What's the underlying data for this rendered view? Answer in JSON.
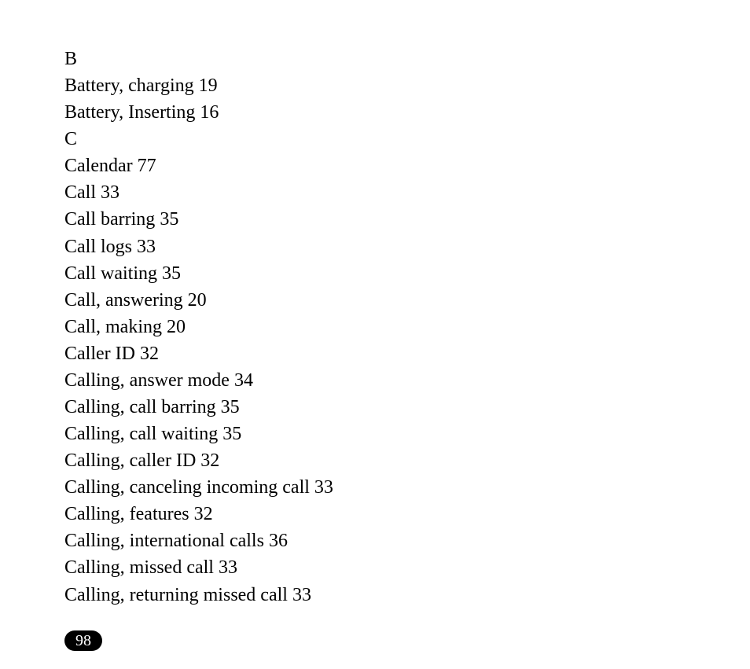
{
  "index": {
    "sections": [
      {
        "letter": "B",
        "entries": [
          {
            "term": "Battery, charging",
            "page": "19"
          },
          {
            "term": "Battery, Inserting",
            "page": "16"
          }
        ]
      },
      {
        "letter": "C",
        "entries": [
          {
            "term": "Calendar",
            "page": "77"
          },
          {
            "term": "Call",
            "page": "33"
          },
          {
            "term": "Call barring",
            "page": "35"
          },
          {
            "term": "Call logs",
            "page": "33"
          },
          {
            "term": "Call waiting",
            "page": "35"
          },
          {
            "term": "Call, answering",
            "page": "20"
          },
          {
            "term": "Call, making",
            "page": "20"
          },
          {
            "term": "Caller ID",
            "page": "32"
          },
          {
            "term": "Calling, answer mode",
            "page": "34"
          },
          {
            "term": "Calling, call barring",
            "page": "35"
          },
          {
            "term": "Calling, call waiting",
            "page": "35"
          },
          {
            "term": "Calling, caller ID",
            "page": "32"
          },
          {
            "term": "Calling, canceling incoming call",
            "page": "33"
          },
          {
            "term": "Calling, features",
            "page": "32"
          },
          {
            "term": "Calling, international calls",
            "page": "36"
          },
          {
            "term": "Calling, missed call",
            "page": "33"
          },
          {
            "term": "Calling, returning missed call",
            "page": "33"
          }
        ]
      }
    ]
  },
  "page_number": "98"
}
